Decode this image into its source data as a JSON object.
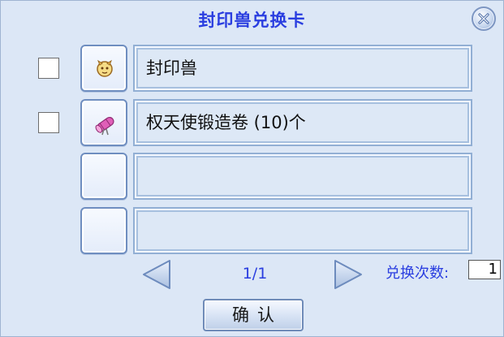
{
  "dialog": {
    "title": "封印兽兑换卡",
    "close_icon": "close-x-icon"
  },
  "items": [
    {
      "name": "封印兽",
      "icon": "sealed-beast-icon",
      "checked": false
    },
    {
      "name": "权天使锻造卷 (10)个",
      "icon": "forge-scroll-icon",
      "checked": false
    },
    {
      "name": "",
      "icon": "",
      "checked": false
    },
    {
      "name": "",
      "icon": "",
      "checked": false
    }
  ],
  "pager": {
    "page": "1/1",
    "prev_icon": "arrow-left-icon",
    "next_icon": "arrow-right-icon"
  },
  "exchange": {
    "count_label": "兑换次数:",
    "count_value": "1"
  },
  "confirm_label": "确认",
  "colors": {
    "background": "#dce7f6",
    "title_text": "#2a3ee0",
    "slot_border": "#6f8ec0"
  }
}
